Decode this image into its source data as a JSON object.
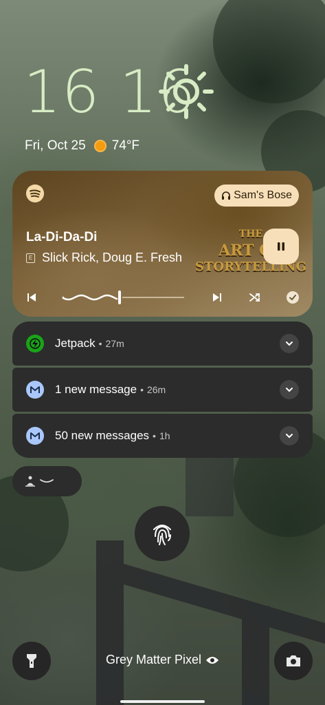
{
  "clock": {
    "time": "16 16"
  },
  "weather": {
    "date": "Fri, Oct 25",
    "temperature": "74°F"
  },
  "media": {
    "output_device": "Sam's Bose",
    "track_title": "La-Di-Da-Di",
    "explicit_badge": "E",
    "artists": "Slick Rick, Doug E. Fresh",
    "album_art_text_1": "THE",
    "album_art_text_2": "ART OF",
    "album_art_text_3": "STORYTELLING",
    "progress": 0.47
  },
  "notifications": [
    {
      "app": "Jetpack",
      "title": "Jetpack",
      "time": "27m",
      "icon_color": "#19a319"
    },
    {
      "app": "Gmail",
      "title": "1 new message",
      "time": "26m",
      "icon_color": "#a9c7fa"
    },
    {
      "app": "Gmail",
      "title": "50 new messages",
      "time": "1h",
      "icon_color": "#a9c7fa"
    }
  ],
  "bottom": {
    "owner_info": "Grey Matter Pixel"
  },
  "colors": {
    "clock": "#d7ecc4",
    "media_accent": "#f7dfba",
    "notif_bg": "#2c2c2c"
  }
}
